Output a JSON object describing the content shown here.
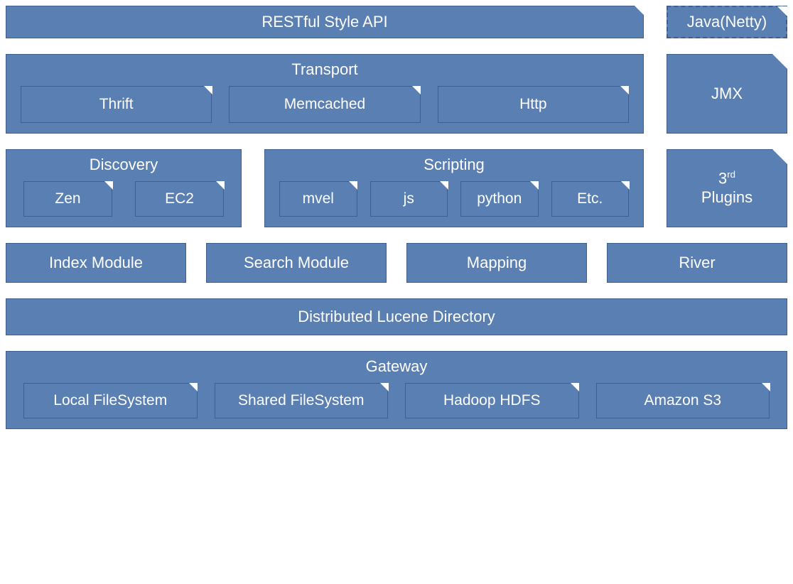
{
  "row1": {
    "rest": "RESTful Style API",
    "java_netty": "Java(Netty)"
  },
  "row2": {
    "transport": {
      "title": "Transport",
      "items": [
        "Thrift",
        "Memcached",
        "Http"
      ]
    },
    "jmx": "JMX"
  },
  "row3": {
    "discovery": {
      "title": "Discovery",
      "items": [
        "Zen",
        "EC2"
      ]
    },
    "scripting": {
      "title": "Scripting",
      "items": [
        "mvel",
        "js",
        "python",
        "Etc."
      ]
    },
    "plugins_line1": "3",
    "plugins_sup": "rd",
    "plugins_line2": "Plugins"
  },
  "row4": {
    "items": [
      "Index Module",
      "Search Module",
      "Mapping",
      "River"
    ]
  },
  "row5": {
    "lucene": "Distributed Lucene Directory"
  },
  "row6": {
    "gateway": {
      "title": "Gateway",
      "items": [
        "Local FileSystem",
        "Shared FileSystem",
        "Hadoop HDFS",
        "Amazon S3"
      ]
    }
  },
  "colors": {
    "fill": "#5a7fb2",
    "border": "#3d5f8f",
    "text": "#ffffff",
    "bg": "#ffffff"
  }
}
